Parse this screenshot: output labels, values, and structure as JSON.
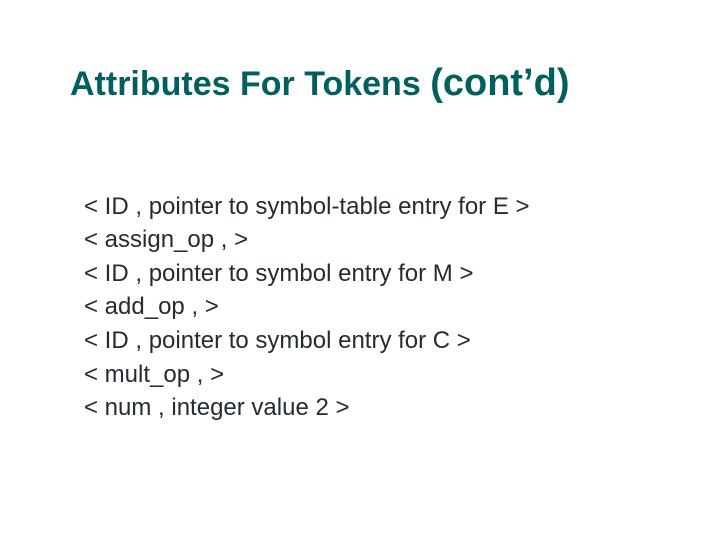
{
  "title": {
    "main": "Attributes For Tokens",
    "contd": "(cont’d)"
  },
  "lines": [
    "< ID , pointer to symbol-table entry for E >",
    "< assign_op ,  >",
    "< ID , pointer to symbol entry for M >",
    "< add_op ,  >",
    "< ID , pointer to symbol entry for C >",
    "< mult_op ,  >",
    "< num , integer value 2 >"
  ]
}
